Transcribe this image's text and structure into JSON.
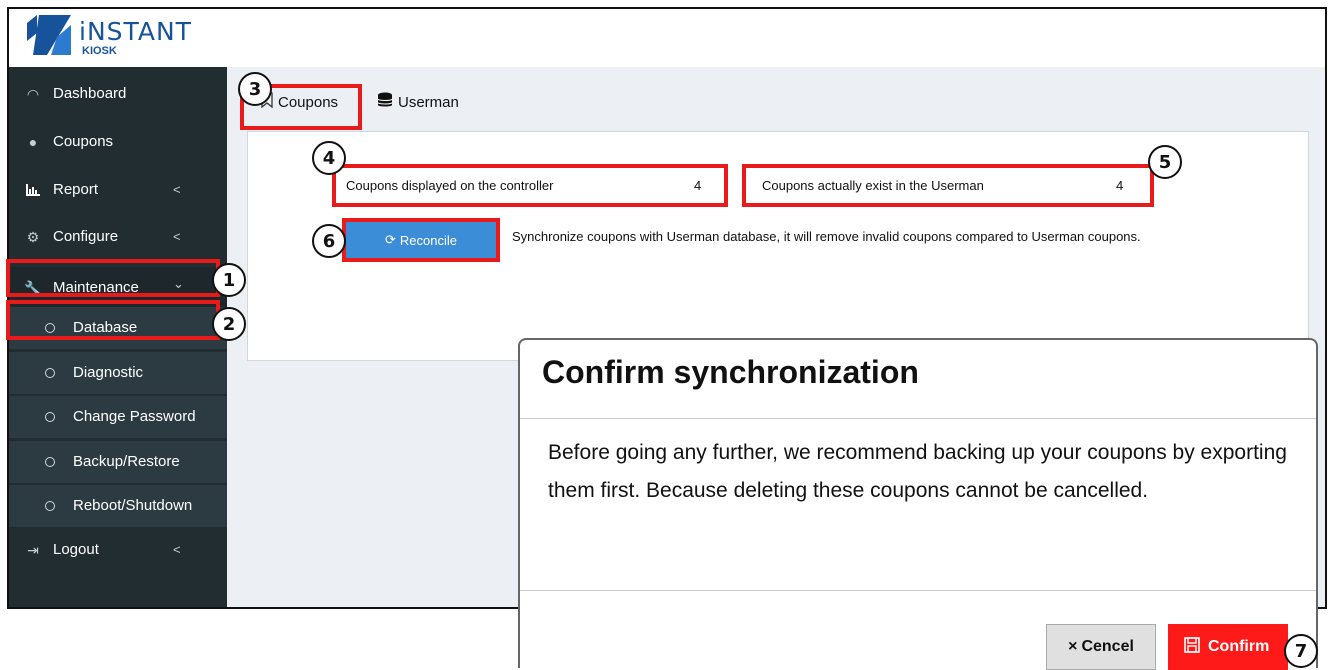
{
  "brand": {
    "name": "iNSTANT",
    "sub": "KIOSK",
    "color": "#17539a"
  },
  "sidebar": {
    "items": [
      {
        "label": "Dashboard",
        "icon": "gauge-icon"
      },
      {
        "label": "Coupons",
        "icon": "tag-icon"
      },
      {
        "label": "Report",
        "icon": "bar-chart-icon",
        "chevron": "<"
      },
      {
        "label": "Configure",
        "icon": "gear-icon",
        "chevron": "<"
      },
      {
        "label": "Maintenance",
        "icon": "wrench-icon",
        "chevron": "⌄"
      }
    ],
    "sub_items": [
      "Database",
      "Diagnostic",
      "Change Password",
      "Backup/Restore",
      "Reboot/Shutdown"
    ],
    "logout": {
      "label": "Logout",
      "icon": "logout-icon",
      "chevron": "<"
    }
  },
  "tabs": [
    {
      "label": "Coupons",
      "icon": "bookmark-icon"
    },
    {
      "label": "Userman",
      "icon": "database-icon"
    }
  ],
  "stats": {
    "controller": {
      "label": "Coupons displayed on the controller",
      "value": "4"
    },
    "userman": {
      "label": "Coupons actually exist in the Userman",
      "value": "4"
    }
  },
  "reconcile": {
    "label": "Reconcile",
    "icon": "sync-icon",
    "description": "Synchronize coupons with Userman database, it will remove invalid coupons compared to Userman coupons."
  },
  "modal": {
    "title": "Confirm synchronization",
    "body": "Before going any further, we recommend backing up your coupons by exporting them first. Because deleting these coupons cannot be cancelled.",
    "cancel": "Cencel",
    "confirm": "Confirm"
  },
  "callouts": [
    "1",
    "2",
    "3",
    "4",
    "5",
    "6",
    "7"
  ],
  "colors": {
    "sidebar": "#222d32",
    "highlight": "#e81a1a",
    "reconcile": "#3c8dd8",
    "confirm": "#ff1a1a"
  }
}
